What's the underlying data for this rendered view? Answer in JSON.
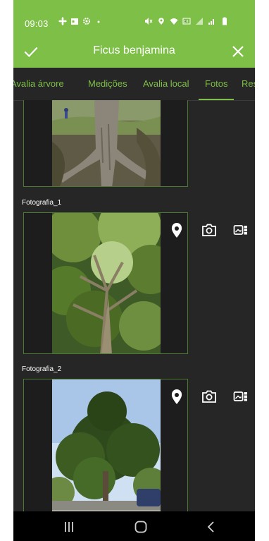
{
  "status_bar": {
    "time": "09:03"
  },
  "app_bar": {
    "title": "Ficus benjamina",
    "confirm_icon": "check-icon",
    "close_icon": "close-icon"
  },
  "tabs": [
    {
      "label": "Avalia árvore",
      "selected": false
    },
    {
      "label": "Medições",
      "selected": false
    },
    {
      "label": "Avalia local",
      "selected": false
    },
    {
      "label": "Fotos",
      "selected": true
    },
    {
      "label": "Resultados",
      "selected": false
    }
  ],
  "photos": [
    {
      "label": ""
    },
    {
      "label": "Fotografia_1"
    },
    {
      "label": "Fotografia_2"
    }
  ],
  "photo_actions": {
    "location_icon": "location-pin-icon",
    "camera_icon": "camera-icon",
    "gallery_icon": "gallery-icon"
  },
  "nav_bar": {
    "recents_icon": "recent-apps-icon",
    "home_icon": "home-icon",
    "back_icon": "back-icon"
  },
  "colors": {
    "accent": "#7dbf47",
    "background": "#262626",
    "frame_border": "#4b7a32"
  }
}
